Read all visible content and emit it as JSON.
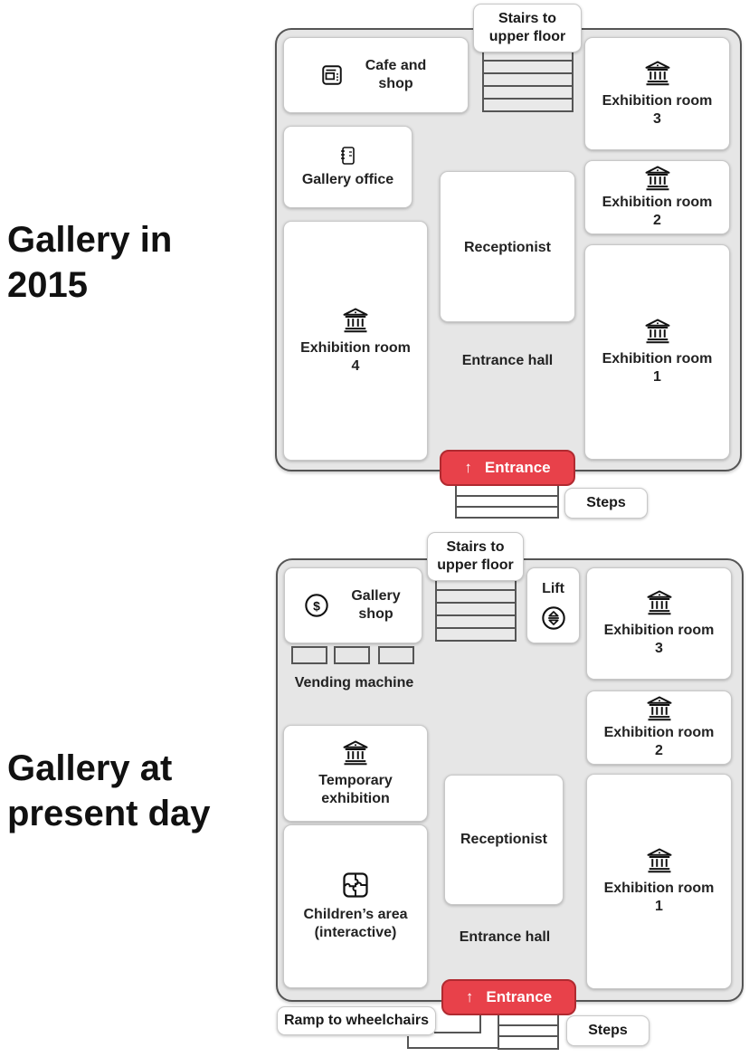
{
  "titles": {
    "plan_2015": "Gallery in 2015",
    "plan_present": "Gallery at present day"
  },
  "plan_2015": {
    "stairs_label": "Stairs to upper floor",
    "cafe_shop": "Cafe and shop",
    "gallery_office": "Gallery office",
    "receptionist": "Receptionist",
    "entrance_hall": "Entrance hall",
    "exhibition_room_1": "Exhibition room 1",
    "exhibition_room_2": "Exhibition room 2",
    "exhibition_room_3": "Exhibition room 3",
    "exhibition_room_4": "Exhibition room 4",
    "entrance": "Entrance",
    "steps": "Steps",
    "icons": {
      "cafe": "coffee-machine-icon",
      "office": "notebook-icon",
      "exhibition": "museum-icon",
      "entrance": "arrow-up-icon"
    }
  },
  "plan_present": {
    "stairs_label": "Stairs to upper floor",
    "gallery_shop": "Gallery shop",
    "lift": "Lift",
    "vending_machine": "Vending machine",
    "temporary_exhibition": "Temporary exhibition",
    "childrens_area": "Children’s area (interactive)",
    "receptionist": "Receptionist",
    "entrance_hall": "Entrance hall",
    "exhibition_room_1": "Exhibition room 1",
    "exhibition_room_2": "Exhibition room 2",
    "exhibition_room_3": "Exhibition room 3",
    "entrance": "Entrance",
    "steps": "Steps",
    "ramp": "Ramp to wheelchairs",
    "icons": {
      "shop": "dollar-coin-icon",
      "lift": "lift-icon",
      "exhibition": "museum-icon",
      "children": "puzzle-icon",
      "entrance": "arrow-up-icon"
    }
  },
  "colors": {
    "entrance": "#e8414a",
    "floor": "#e6e6e6",
    "room": "#ffffff"
  }
}
